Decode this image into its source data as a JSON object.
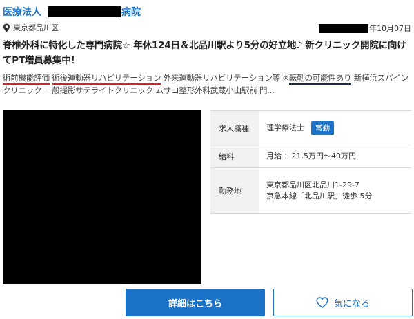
{
  "header": {
    "org_prefix": "医療法人",
    "org_suffix": "病院"
  },
  "meta": {
    "location_icon": "location-pin-icon",
    "location": "東京都品川区",
    "date": "年10月07日"
  },
  "title": "脊椎外科に特化した専門病院☆ 年休124日＆北品川駅より5分の好立地♪ 新クリニック開院に向けてPT増員募集中！",
  "tags": {
    "tag1": "術前機能評価",
    "tag2": "術後運動器リハビリテーション",
    "tag3": "外来運動器リハビリテーション等",
    "note_prefix": "※",
    "note": "転勤の可能性あり",
    "rest": "新横浜スパインクリニック 一般撮影サテライトクリニック ムサコ整形外科武蔵小山駅前 門..."
  },
  "info": {
    "job_label": "求人職種",
    "job_value": "理学療法士",
    "employment_badge": "常勤",
    "salary_label": "給料",
    "salary_value": "月給 ：21.5万円〜40万円",
    "location_label": "勤務地",
    "address_line1": "東京都品川区北品川1-29-7",
    "address_line2": "京急本線「北品川駅」徒歩 5分"
  },
  "buttons": {
    "detail": "詳細はこちら",
    "favorite": "気になる",
    "favorite_icon": "heart-outline-icon"
  },
  "colors": {
    "accent": "#1a73c8",
    "underline_red": "#e51c1c",
    "underline_dark": "#1c2a4a"
  }
}
